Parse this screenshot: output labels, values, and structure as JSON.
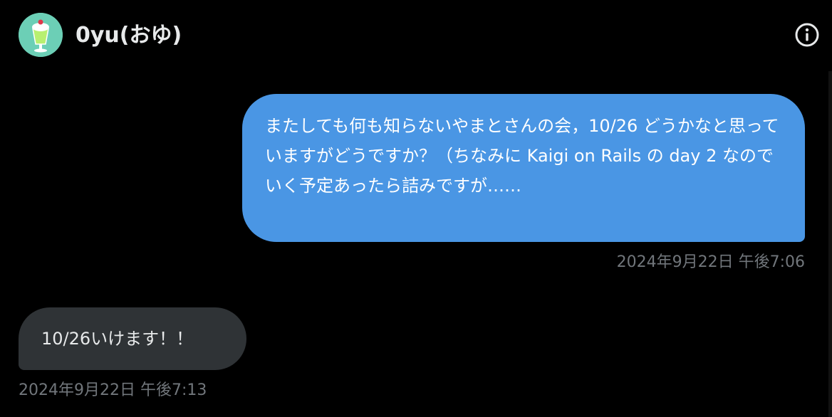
{
  "header": {
    "title": "0yu(おゆ)",
    "avatar_icon": "cream-soda-avatar",
    "info_icon": "info-icon"
  },
  "messages": [
    {
      "direction": "outgoing",
      "text": "またしても何も知らないやまとさんの会，10/26 どうかなと思っていますがどうですか？（ちなみに Kaigi on Rails の day 2 なのでいく予定あったら詰みですが……",
      "timestamp": "2024年9月22日 午後7:06"
    },
    {
      "direction": "incoming",
      "text": "10/26いけます！！",
      "timestamp": "2024年9月22日 午後7:13"
    }
  ],
  "colors": {
    "background": "#000000",
    "outgoing_bubble": "#4a96e4",
    "incoming_bubble": "#2f3336",
    "timestamp": "#71767b",
    "text": "#e7e9ea"
  }
}
